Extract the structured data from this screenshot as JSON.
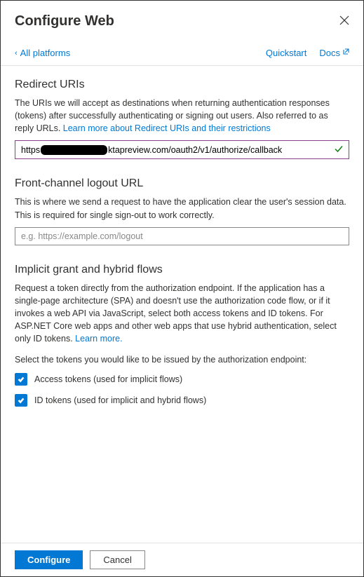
{
  "header": {
    "title": "Configure Web"
  },
  "topbar": {
    "back_label": "All platforms",
    "quickstart_label": "Quickstart",
    "docs_label": "Docs"
  },
  "redirect": {
    "title": "Redirect URIs",
    "desc_part1": "The URIs we will accept as destinations when returning authentication responses (tokens) after successfully authenticating or signing out users. Also referred to as reply URLs. ",
    "link": "Learn more about Redirect URIs and their restrictions",
    "input_prefix": "https",
    "input_suffix": "ktapreview.com/oauth2/v1/authorize/callback"
  },
  "logout": {
    "title": "Front-channel logout URL",
    "desc": "This is where we send a request to have the application clear the user's session data. This is required for single sign-out to work correctly.",
    "placeholder": "e.g. https://example.com/logout"
  },
  "implicit": {
    "title": "Implicit grant and hybrid flows",
    "desc_part1": "Request a token directly from the authorization endpoint. If the application has a single-page architecture (SPA) and doesn't use the authorization code flow, or if it invokes a web API via JavaScript, select both access tokens and ID tokens. For ASP.NET Core web apps and other web apps that use hybrid authentication, select only ID tokens. ",
    "link": "Learn more.",
    "select_text": "Select the tokens you would like to be issued by the authorization endpoint:",
    "access_tokens_label": "Access tokens (used for implicit flows)",
    "id_tokens_label": "ID tokens (used for implicit and hybrid flows)"
  },
  "footer": {
    "configure_label": "Configure",
    "cancel_label": "Cancel"
  }
}
